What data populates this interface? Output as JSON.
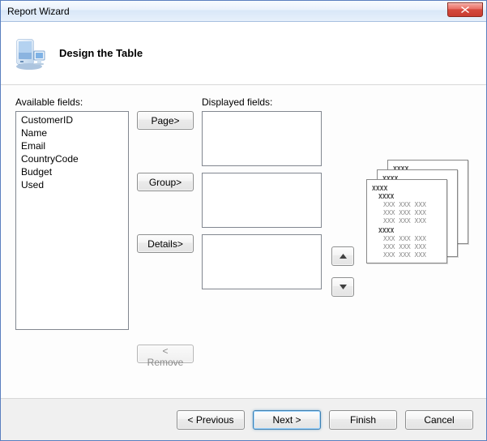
{
  "window": {
    "title": "Report Wizard"
  },
  "header": {
    "heading": "Design the Table"
  },
  "labels": {
    "available": "Available fields:",
    "displayed": "Displayed fields:"
  },
  "available_fields": [
    "CustomerID",
    "Name",
    "Email",
    "CountryCode",
    "Budget",
    "Used"
  ],
  "buttons": {
    "page": "Page>",
    "group": "Group>",
    "details": "Details>",
    "remove": "< Remove",
    "up": "▲",
    "down": "▼",
    "previous": "< Previous",
    "next": "Next >",
    "finish": "Finish",
    "cancel": "Cancel"
  }
}
